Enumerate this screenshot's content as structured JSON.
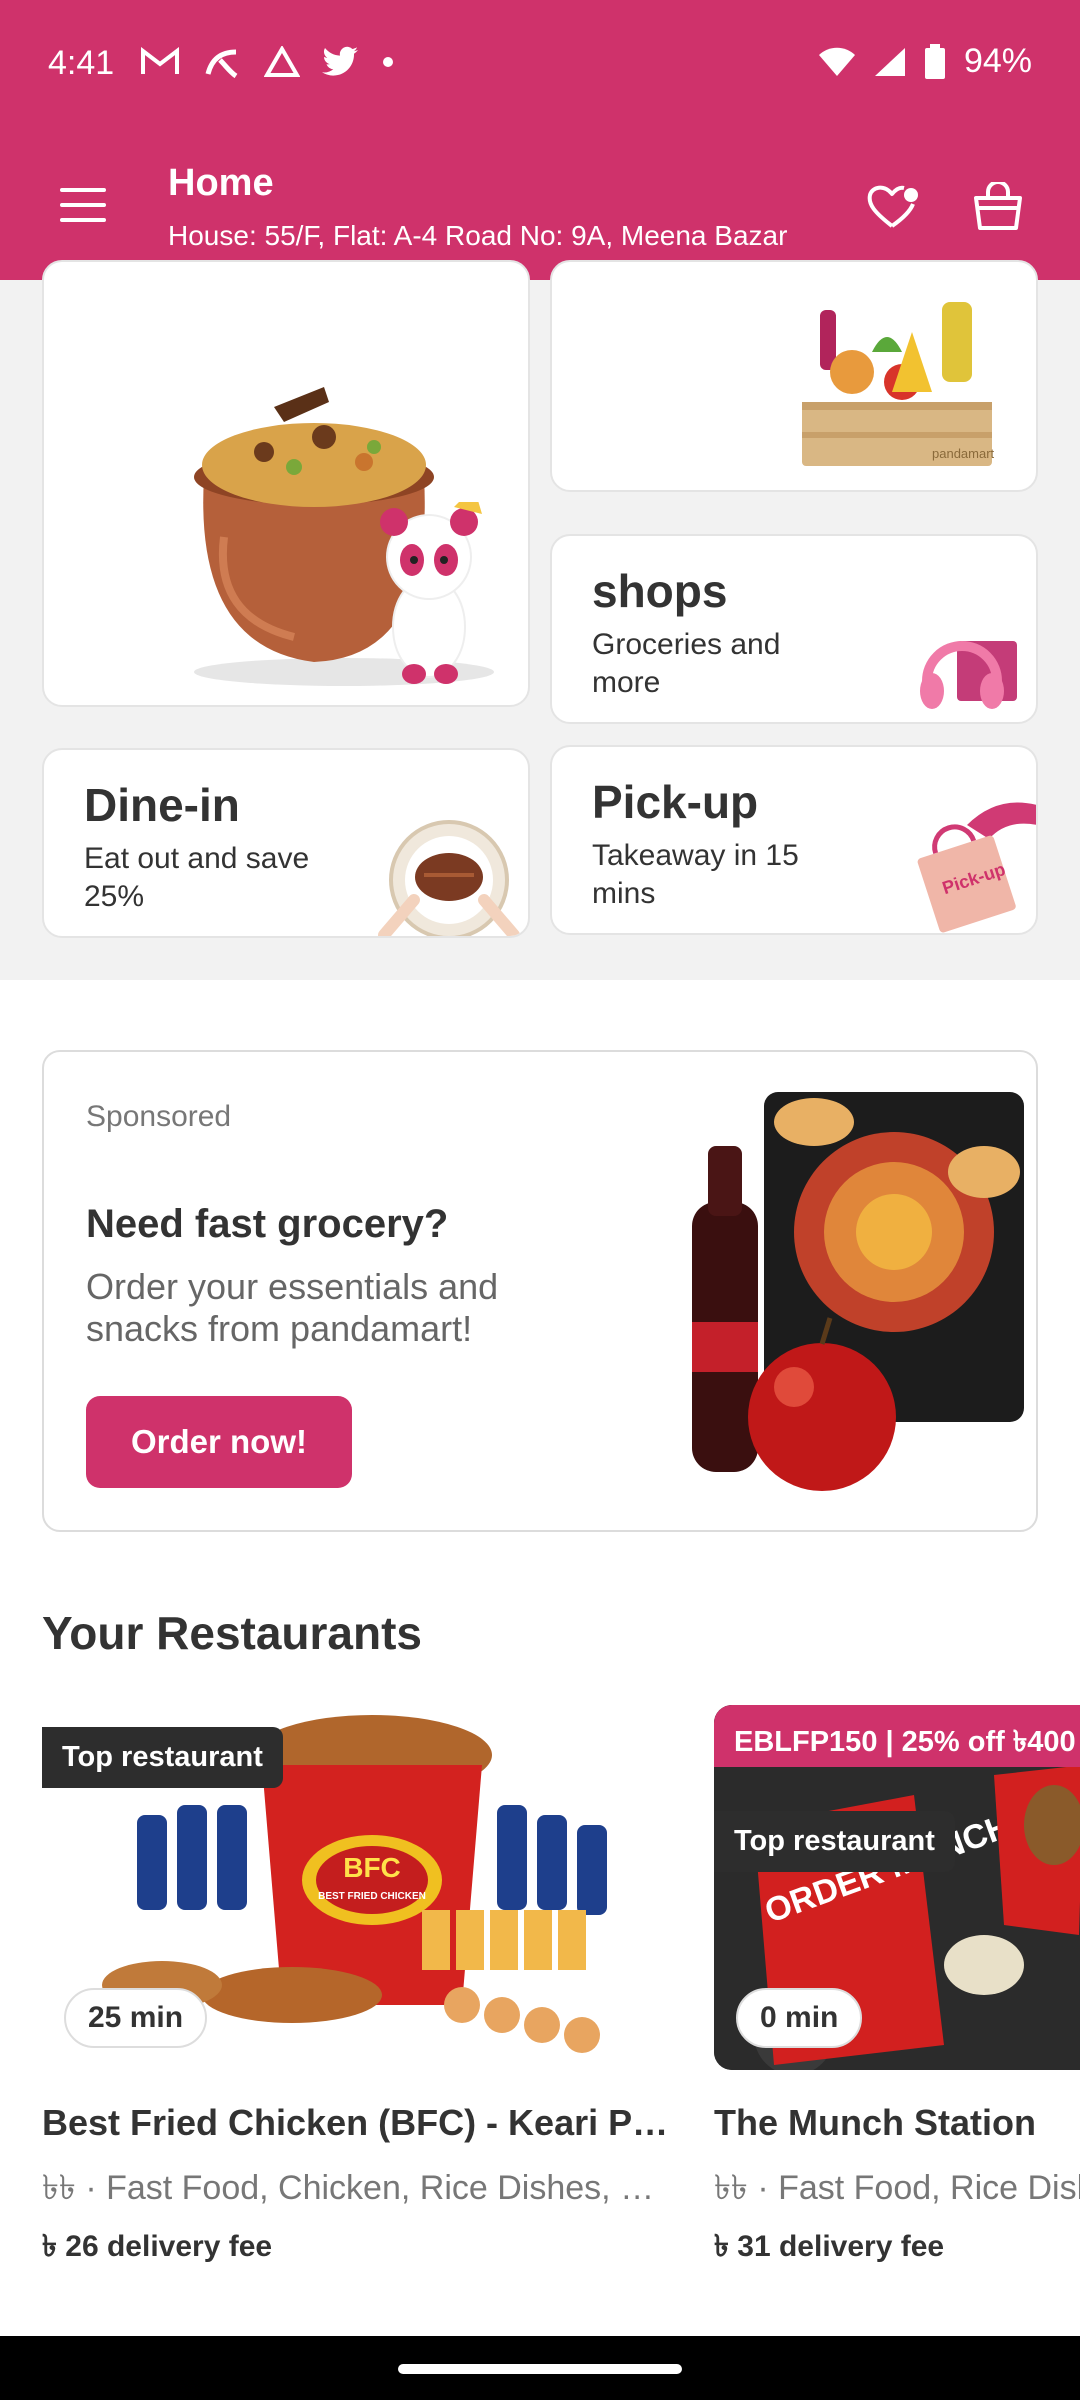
{
  "status_bar": {
    "time": "4:41",
    "battery": "94%",
    "icons": [
      "gmail-icon",
      "telenor-icon",
      "drive-icon",
      "twitter-icon",
      "dot-icon",
      "wifi-icon",
      "signal-icon",
      "battery-icon"
    ]
  },
  "header": {
    "title": "Home",
    "address": "House: 55/F, Flat: A-4 Road No: 9A, Meena Bazar",
    "icons": [
      "menu-icon",
      "favourites-icon",
      "cart-icon"
    ]
  },
  "tiles": {
    "food_brand": "panda",
    "mart_brand": "pandamart",
    "shops_title": "shops",
    "shops_sub": "Groceries and more",
    "dinein_title": "Dine-in",
    "dinein_sub": "Eat out and save 25%",
    "pickup_title": "Pick-up",
    "pickup_sub": "Takeaway in 15 mins",
    "pickup_bag_label": "Pick-up"
  },
  "ad": {
    "label": "Sponsored",
    "title": "Need fast grocery?",
    "subtitle": "Order your essentials and snacks from pandamart!",
    "button": "Order now!"
  },
  "restaurants": {
    "section_title": "Your Restaurants",
    "items": [
      {
        "badge": "Top restaurant",
        "time": "25 min",
        "name": "Best Fried Chicken (BFC) - Keari Plaza",
        "cuisine": "৳৳ · Fast Food, Chicken, Rice Dishes, Burgers",
        "fee": "৳ 26 delivery fee",
        "logo_text": "BFC",
        "logo_sub": "BEST FRIED CHICKEN"
      },
      {
        "promo": "EBLFP150 | 25% off ৳400",
        "badge": "Top restaurant",
        "time": "0 min",
        "name": "The Munch Station",
        "cuisine": "৳৳ · Fast Food, Rice Dishes",
        "fee": "৳ 31 delivery fee",
        "box_text": "ORDER MUNCH SIP"
      }
    ]
  },
  "colors": {
    "brand": "#cf326b",
    "dark_badge": "#2d2d2d",
    "tile_bg": "#f2f2f2"
  }
}
